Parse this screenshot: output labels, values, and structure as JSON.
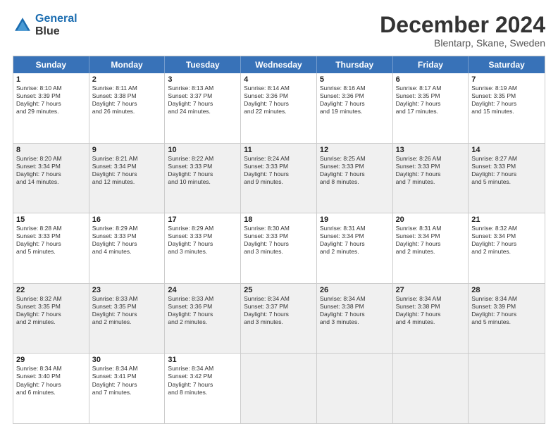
{
  "logo": {
    "line1": "General",
    "line2": "Blue"
  },
  "title": "December 2024",
  "subtitle": "Blentarp, Skane, Sweden",
  "header": {
    "days": [
      "Sunday",
      "Monday",
      "Tuesday",
      "Wednesday",
      "Thursday",
      "Friday",
      "Saturday"
    ]
  },
  "rows": [
    [
      {
        "day": "1",
        "lines": [
          "Sunrise: 8:10 AM",
          "Sunset: 3:39 PM",
          "Daylight: 7 hours",
          "and 29 minutes."
        ],
        "shade": false
      },
      {
        "day": "2",
        "lines": [
          "Sunrise: 8:11 AM",
          "Sunset: 3:38 PM",
          "Daylight: 7 hours",
          "and 26 minutes."
        ],
        "shade": false
      },
      {
        "day": "3",
        "lines": [
          "Sunrise: 8:13 AM",
          "Sunset: 3:37 PM",
          "Daylight: 7 hours",
          "and 24 minutes."
        ],
        "shade": false
      },
      {
        "day": "4",
        "lines": [
          "Sunrise: 8:14 AM",
          "Sunset: 3:36 PM",
          "Daylight: 7 hours",
          "and 22 minutes."
        ],
        "shade": false
      },
      {
        "day": "5",
        "lines": [
          "Sunrise: 8:16 AM",
          "Sunset: 3:36 PM",
          "Daylight: 7 hours",
          "and 19 minutes."
        ],
        "shade": false
      },
      {
        "day": "6",
        "lines": [
          "Sunrise: 8:17 AM",
          "Sunset: 3:35 PM",
          "Daylight: 7 hours",
          "and 17 minutes."
        ],
        "shade": false
      },
      {
        "day": "7",
        "lines": [
          "Sunrise: 8:19 AM",
          "Sunset: 3:35 PM",
          "Daylight: 7 hours",
          "and 15 minutes."
        ],
        "shade": false
      }
    ],
    [
      {
        "day": "8",
        "lines": [
          "Sunrise: 8:20 AM",
          "Sunset: 3:34 PM",
          "Daylight: 7 hours",
          "and 14 minutes."
        ],
        "shade": true
      },
      {
        "day": "9",
        "lines": [
          "Sunrise: 8:21 AM",
          "Sunset: 3:34 PM",
          "Daylight: 7 hours",
          "and 12 minutes."
        ],
        "shade": true
      },
      {
        "day": "10",
        "lines": [
          "Sunrise: 8:22 AM",
          "Sunset: 3:33 PM",
          "Daylight: 7 hours",
          "and 10 minutes."
        ],
        "shade": true
      },
      {
        "day": "11",
        "lines": [
          "Sunrise: 8:24 AM",
          "Sunset: 3:33 PM",
          "Daylight: 7 hours",
          "and 9 minutes."
        ],
        "shade": true
      },
      {
        "day": "12",
        "lines": [
          "Sunrise: 8:25 AM",
          "Sunset: 3:33 PM",
          "Daylight: 7 hours",
          "and 8 minutes."
        ],
        "shade": true
      },
      {
        "day": "13",
        "lines": [
          "Sunrise: 8:26 AM",
          "Sunset: 3:33 PM",
          "Daylight: 7 hours",
          "and 7 minutes."
        ],
        "shade": true
      },
      {
        "day": "14",
        "lines": [
          "Sunrise: 8:27 AM",
          "Sunset: 3:33 PM",
          "Daylight: 7 hours",
          "and 5 minutes."
        ],
        "shade": true
      }
    ],
    [
      {
        "day": "15",
        "lines": [
          "Sunrise: 8:28 AM",
          "Sunset: 3:33 PM",
          "Daylight: 7 hours",
          "and 5 minutes."
        ],
        "shade": false
      },
      {
        "day": "16",
        "lines": [
          "Sunrise: 8:29 AM",
          "Sunset: 3:33 PM",
          "Daylight: 7 hours",
          "and 4 minutes."
        ],
        "shade": false
      },
      {
        "day": "17",
        "lines": [
          "Sunrise: 8:29 AM",
          "Sunset: 3:33 PM",
          "Daylight: 7 hours",
          "and 3 minutes."
        ],
        "shade": false
      },
      {
        "day": "18",
        "lines": [
          "Sunrise: 8:30 AM",
          "Sunset: 3:33 PM",
          "Daylight: 7 hours",
          "and 3 minutes."
        ],
        "shade": false
      },
      {
        "day": "19",
        "lines": [
          "Sunrise: 8:31 AM",
          "Sunset: 3:34 PM",
          "Daylight: 7 hours",
          "and 2 minutes."
        ],
        "shade": false
      },
      {
        "day": "20",
        "lines": [
          "Sunrise: 8:31 AM",
          "Sunset: 3:34 PM",
          "Daylight: 7 hours",
          "and 2 minutes."
        ],
        "shade": false
      },
      {
        "day": "21",
        "lines": [
          "Sunrise: 8:32 AM",
          "Sunset: 3:34 PM",
          "Daylight: 7 hours",
          "and 2 minutes."
        ],
        "shade": false
      }
    ],
    [
      {
        "day": "22",
        "lines": [
          "Sunrise: 8:32 AM",
          "Sunset: 3:35 PM",
          "Daylight: 7 hours",
          "and 2 minutes."
        ],
        "shade": true
      },
      {
        "day": "23",
        "lines": [
          "Sunrise: 8:33 AM",
          "Sunset: 3:35 PM",
          "Daylight: 7 hours",
          "and 2 minutes."
        ],
        "shade": true
      },
      {
        "day": "24",
        "lines": [
          "Sunrise: 8:33 AM",
          "Sunset: 3:36 PM",
          "Daylight: 7 hours",
          "and 2 minutes."
        ],
        "shade": true
      },
      {
        "day": "25",
        "lines": [
          "Sunrise: 8:34 AM",
          "Sunset: 3:37 PM",
          "Daylight: 7 hours",
          "and 3 minutes."
        ],
        "shade": true
      },
      {
        "day": "26",
        "lines": [
          "Sunrise: 8:34 AM",
          "Sunset: 3:38 PM",
          "Daylight: 7 hours",
          "and 3 minutes."
        ],
        "shade": true
      },
      {
        "day": "27",
        "lines": [
          "Sunrise: 8:34 AM",
          "Sunset: 3:38 PM",
          "Daylight: 7 hours",
          "and 4 minutes."
        ],
        "shade": true
      },
      {
        "day": "28",
        "lines": [
          "Sunrise: 8:34 AM",
          "Sunset: 3:39 PM",
          "Daylight: 7 hours",
          "and 5 minutes."
        ],
        "shade": true
      }
    ],
    [
      {
        "day": "29",
        "lines": [
          "Sunrise: 8:34 AM",
          "Sunset: 3:40 PM",
          "Daylight: 7 hours",
          "and 6 minutes."
        ],
        "shade": false
      },
      {
        "day": "30",
        "lines": [
          "Sunrise: 8:34 AM",
          "Sunset: 3:41 PM",
          "Daylight: 7 hours",
          "and 7 minutes."
        ],
        "shade": false
      },
      {
        "day": "31",
        "lines": [
          "Sunrise: 8:34 AM",
          "Sunset: 3:42 PM",
          "Daylight: 7 hours",
          "and 8 minutes."
        ],
        "shade": false
      },
      {
        "day": "",
        "lines": [],
        "shade": true,
        "empty": true
      },
      {
        "day": "",
        "lines": [],
        "shade": true,
        "empty": true
      },
      {
        "day": "",
        "lines": [],
        "shade": true,
        "empty": true
      },
      {
        "day": "",
        "lines": [],
        "shade": true,
        "empty": true
      }
    ]
  ]
}
